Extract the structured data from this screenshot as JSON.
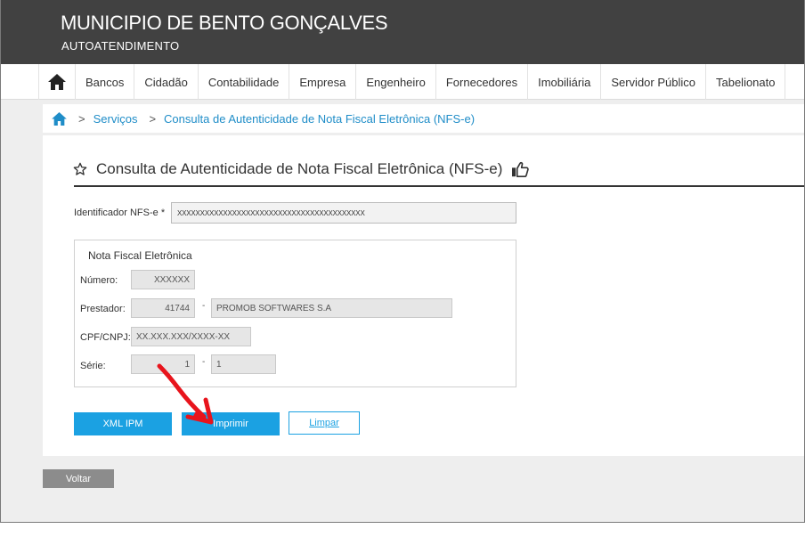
{
  "header": {
    "title": "MUNICIPIO DE BENTO GONÇALVES",
    "subtitle": "AUTOATENDIMENTO"
  },
  "nav": {
    "home_icon": "home-icon",
    "items": [
      "Bancos",
      "Cidadão",
      "Contabilidade",
      "Empresa",
      "Engenheiro",
      "Fornecedores",
      "Imobiliária",
      "Servidor Público",
      "Tabelionato"
    ]
  },
  "breadcrumb": {
    "home_icon": "home-icon",
    "separator": ">",
    "items": [
      "Serviços",
      "Consulta de Autenticidade de Nota Fiscal Eletrônica (NFS-e)"
    ]
  },
  "page": {
    "star_icon": "star-outline-icon",
    "title": "Consulta de Autenticidade de Nota Fiscal Eletrônica (NFS-e)",
    "like_icon": "thumbs-up-icon"
  },
  "form": {
    "id_label": "Identificador NFS-e *",
    "id_value": "XXXXXXXXXXXXXXXXXXXXXXXXXXXXXXXXXXXXXXXXX"
  },
  "nota": {
    "legend": "Nota Fiscal Eletrônica",
    "numero_label": "Número:",
    "numero_value": "XXXXXX",
    "prestador_label": "Prestador:",
    "prestador_code": "41744",
    "prestador_name": "PROMOB SOFTWARES S.A",
    "cpf_label": "CPF/CNPJ:",
    "cpf_value": "XX.XXX.XXX/XXXX-XX",
    "serie_label": "Série:",
    "serie_value": "1",
    "serie_value2": "1",
    "dash": "-"
  },
  "buttons": {
    "xml": "XML IPM",
    "imprimir": "Imprimir",
    "limpar": "Limpar",
    "voltar": "Voltar"
  },
  "colors": {
    "header_bg": "#414141",
    "accent": "#1ba1e2",
    "link": "#1f8dc8",
    "annotation_arrow": "#e8141c"
  }
}
